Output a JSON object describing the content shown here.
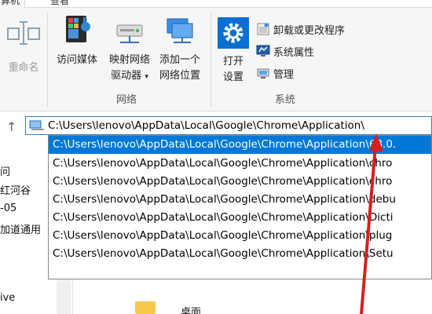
{
  "ribbon": {
    "tabs": [
      "算机",
      "查看"
    ],
    "buttons": {
      "rename": "重命名",
      "media": "访问媒体",
      "map_drive_line1": "映射网络",
      "map_drive_line2": "驱动器",
      "add_location_line1": "添加一个",
      "add_location_line2": "网络位置",
      "open_settings_line1": "打开",
      "open_settings_line2": "设置"
    },
    "small_items": {
      "uninstall": "卸载或更改程序",
      "system_properties": "系统属性",
      "manage": "管理"
    },
    "groups": {
      "network": "网络",
      "system": "系统"
    }
  },
  "address_bar": {
    "path": "C:\\Users\\lenovo\\AppData\\Local\\Google\\Chrome\\Application\\"
  },
  "dropdown": {
    "items": [
      "C:\\Users\\lenovo\\AppData\\Local\\Google\\Chrome\\Application\\68.0.",
      "C:\\Users\\lenovo\\AppData\\Local\\Google\\Chrome\\Application\\chro",
      "C:\\Users\\lenovo\\AppData\\Local\\Google\\Chrome\\Application\\chro",
      "C:\\Users\\lenovo\\AppData\\Local\\Google\\Chrome\\Application\\debu",
      "C:\\Users\\lenovo\\AppData\\Local\\Google\\Chrome\\Application\\Dicti",
      "C:\\Users\\lenovo\\AppData\\Local\\Google\\Chrome\\Application\\plug",
      "C:\\Users\\lenovo\\AppData\\Local\\Google\\Chrome\\Application\\Setu"
    ],
    "selected_index": 0
  },
  "left_pane": {
    "items": [
      "问",
      "红河谷",
      "-05",
      "加道通用",
      "ive"
    ]
  },
  "content": {
    "folder_label": "桌面"
  },
  "colors": {
    "selection": "#0078d7",
    "annotation_arrow": "#d81e1e",
    "ribbon_bg": "#f5f6f7"
  }
}
